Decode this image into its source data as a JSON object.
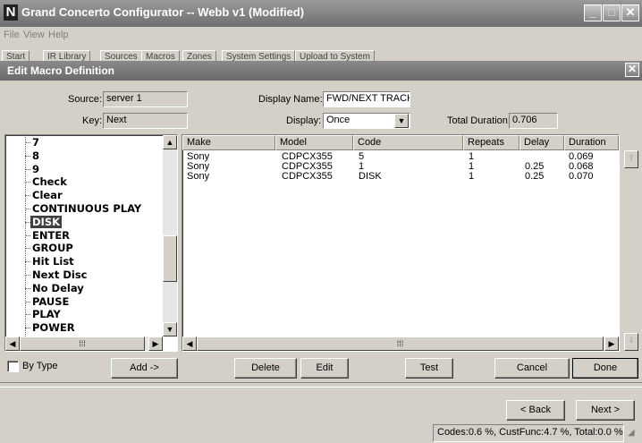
{
  "app": {
    "title": "Grand Concerto Configurator -- Webb v1 (Modified)",
    "logo": "N",
    "menu": [
      "File",
      "View",
      "Help"
    ],
    "tabs": [
      "Start",
      "IR Library",
      "Sources",
      "Macros",
      "Zones",
      "System Settings",
      "Upload to System"
    ]
  },
  "dialog": {
    "title": "Edit Macro Definition",
    "source_label": "Source:",
    "source_value": "server 1",
    "key_label": "Key:",
    "key_value": "Next",
    "display_name_label": "Display Name:",
    "display_name_value": "FWD/NEXT TRACK",
    "display_label": "Display:",
    "display_value": "Once",
    "total_duration_label": "Total Duration:",
    "total_duration_value": "0.706"
  },
  "key_list": {
    "items": [
      "7",
      "8",
      "9",
      "Check",
      "Clear",
      "CONTINUOUS PLAY",
      "DISK",
      "ENTER",
      "GROUP",
      "Hit List",
      "Next Disc",
      "No Delay",
      "PAUSE",
      "PLAY",
      "POWER"
    ],
    "selected": "DISK",
    "by_type_label": "By Type"
  },
  "table": {
    "columns": [
      "Make",
      "Model",
      "Code",
      "Repeats",
      "Delay",
      "Duration"
    ],
    "rows": [
      {
        "make": "Sony",
        "model": "CDPCX355",
        "code": "5",
        "repeats": "1",
        "delay": "",
        "duration": "0.069"
      },
      {
        "make": "Sony",
        "model": "CDPCX355",
        "code": "1",
        "repeats": "1",
        "delay": "0.25",
        "duration": "0.068"
      },
      {
        "make": "Sony",
        "model": "CDPCX355",
        "code": "DISK",
        "repeats": "1",
        "delay": "0.25",
        "duration": "0.070"
      }
    ]
  },
  "buttons": {
    "add": "Add ->",
    "delete": "Delete",
    "edit": "Edit",
    "test": "Test",
    "cancel": "Cancel",
    "done": "Done",
    "back": "< Back",
    "next": "Next >"
  },
  "status": {
    "text": "Codes:0.6 %, CustFunc:4.7 %, Total:0.0 %"
  }
}
